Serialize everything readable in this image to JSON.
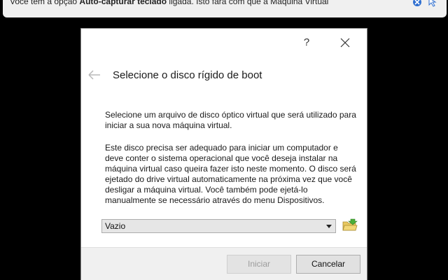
{
  "notification": {
    "text_prefix": "Você tem a opção ",
    "text_bold": "Auto-capturar teclado",
    "text_suffix": " ligada. Isto fará com que a Máquina Virtual"
  },
  "dialog": {
    "help_label": "?",
    "heading": "Selecione o disco rígido de boot",
    "paragraph1": "Selecione um arquivo de disco óptico virtual que será utilizado para iniciar a sua nova máquina virtual.",
    "paragraph2": "Este disco precisa ser adequado para iniciar um computador e deve conter o sistema operacional que você deseja instalar na máquina virtual caso queira fazer isto neste momento. O disco será ejetado do drive virtual automaticamente na próxima vez que você desligar a máquina virtual. Você também pode ejetá-lo manualmente se necessário através do menu Dispositivos.",
    "disk_select_value": "Vazio",
    "start_button": "Iniciar",
    "cancel_button": "Cancelar"
  },
  "icons": {
    "notify_close": "close-circle-icon",
    "notify_mouse": "mouse-capture-icon",
    "back": "back-arrow-icon",
    "close": "close-icon",
    "folder": "folder-open-icon"
  },
  "colors": {
    "notify_icon_blue": "#2f6fd0",
    "folder_green": "#4caf3a",
    "folder_yellow": "#e8c860"
  }
}
